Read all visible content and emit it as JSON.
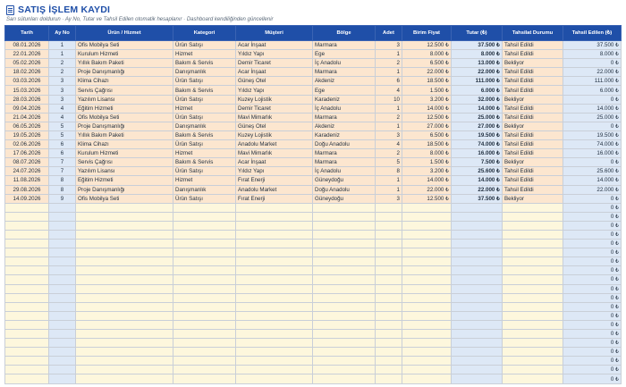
{
  "header": {
    "title": "SATIŞ İŞLEM KAYDI",
    "subtitle": "Sarı sütunları doldurun · Ay No, Tutar ve Tahsil Edilen otomatik hesaplanır · Dashboard kendiliğinden güncellenir"
  },
  "columns": [
    "Tarih",
    "Ay No",
    "Ürün / Hizmet",
    "Kategori",
    "Müşteri",
    "Bölge",
    "Adet",
    "Birim Fiyat",
    "Tutar (₺)",
    "Tahsilat Durumu",
    "Tahsil Edilen (₺)"
  ],
  "rows": [
    [
      "08.01.2026",
      "1",
      "Ofis Mobilya Seti",
      "Ürün Satışı",
      "Acar İnşaat",
      "Marmara",
      "3",
      "12.500 ₺",
      "37.500 ₺",
      "Tahsil Edildi",
      "37.500 ₺"
    ],
    [
      "22.01.2026",
      "1",
      "Kurulum Hizmeti",
      "Hizmet",
      "Yıldız Yapı",
      "Ege",
      "1",
      "8.000 ₺",
      "8.000 ₺",
      "Tahsil Edildi",
      "8.000 ₺"
    ],
    [
      "05.02.2026",
      "2",
      "Yıllık Bakım Paketi",
      "Bakım & Servis",
      "Demir Ticaret",
      "İç Anadolu",
      "2",
      "6.500 ₺",
      "13.000 ₺",
      "Bekliyor",
      "0 ₺"
    ],
    [
      "18.02.2026",
      "2",
      "Proje Danışmanlığı",
      "Danışmanlık",
      "Acar İnşaat",
      "Marmara",
      "1",
      "22.000 ₺",
      "22.000 ₺",
      "Tahsil Edildi",
      "22.000 ₺"
    ],
    [
      "03.03.2026",
      "3",
      "Klima Cihazı",
      "Ürün Satışı",
      "Güneş Otel",
      "Akdeniz",
      "6",
      "18.500 ₺",
      "111.000 ₺",
      "Tahsil Edildi",
      "111.000 ₺"
    ],
    [
      "15.03.2026",
      "3",
      "Servis Çağrısı",
      "Bakım & Servis",
      "Yıldız Yapı",
      "Ege",
      "4",
      "1.500 ₺",
      "6.000 ₺",
      "Tahsil Edildi",
      "6.000 ₺"
    ],
    [
      "28.03.2026",
      "3",
      "Yazılım Lisansı",
      "Ürün Satışı",
      "Kuzey Lojistik",
      "Karadeniz",
      "10",
      "3.200 ₺",
      "32.000 ₺",
      "Bekliyor",
      "0 ₺"
    ],
    [
      "09.04.2026",
      "4",
      "Eğitim Hizmeti",
      "Hizmet",
      "Demir Ticaret",
      "İç Anadolu",
      "1",
      "14.000 ₺",
      "14.000 ₺",
      "Tahsil Edildi",
      "14.000 ₺"
    ],
    [
      "21.04.2026",
      "4",
      "Ofis Mobilya Seti",
      "Ürün Satışı",
      "Mavi Mimarlık",
      "Marmara",
      "2",
      "12.500 ₺",
      "25.000 ₺",
      "Tahsil Edildi",
      "25.000 ₺"
    ],
    [
      "06.05.2026",
      "5",
      "Proje Danışmanlığı",
      "Danışmanlık",
      "Güneş Otel",
      "Akdeniz",
      "1",
      "27.000 ₺",
      "27.000 ₺",
      "Bekliyor",
      "0 ₺"
    ],
    [
      "19.05.2026",
      "5",
      "Yıllık Bakım Paketi",
      "Bakım & Servis",
      "Kuzey Lojistik",
      "Karadeniz",
      "3",
      "6.500 ₺",
      "19.500 ₺",
      "Tahsil Edildi",
      "19.500 ₺"
    ],
    [
      "02.06.2026",
      "6",
      "Klima Cihazı",
      "Ürün Satışı",
      "Anadolu Market",
      "Doğu Anadolu",
      "4",
      "18.500 ₺",
      "74.000 ₺",
      "Tahsil Edildi",
      "74.000 ₺"
    ],
    [
      "17.06.2026",
      "6",
      "Kurulum Hizmeti",
      "Hizmet",
      "Mavi Mimarlık",
      "Marmara",
      "2",
      "8.000 ₺",
      "16.000 ₺",
      "Tahsil Edildi",
      "16.000 ₺"
    ],
    [
      "08.07.2026",
      "7",
      "Servis Çağrısı",
      "Bakım & Servis",
      "Acar İnşaat",
      "Marmara",
      "5",
      "1.500 ₺",
      "7.500 ₺",
      "Bekliyor",
      "0 ₺"
    ],
    [
      "24.07.2026",
      "7",
      "Yazılım Lisansı",
      "Ürün Satışı",
      "Yıldız Yapı",
      "İç Anadolu",
      "8",
      "3.200 ₺",
      "25.600 ₺",
      "Tahsil Edildi",
      "25.600 ₺"
    ],
    [
      "11.08.2026",
      "8",
      "Eğitim Hizmeti",
      "Hizmet",
      "Fırat Enerji",
      "Güneydoğu",
      "1",
      "14.000 ₺",
      "14.000 ₺",
      "Tahsil Edildi",
      "14.000 ₺"
    ],
    [
      "29.08.2026",
      "8",
      "Proje Danışmanlığı",
      "Danışmanlık",
      "Anadolu Market",
      "Doğu Anadolu",
      "1",
      "22.000 ₺",
      "22.000 ₺",
      "Tahsil Edildi",
      "22.000 ₺"
    ],
    [
      "14.09.2026",
      "9",
      "Ofis Mobilya Seti",
      "Ürün Satışı",
      "Fırat Enerji",
      "Güneydoğu",
      "3",
      "12.500 ₺",
      "37.500 ₺",
      "Bekliyor",
      "0 ₺"
    ]
  ],
  "empty_rows": 20,
  "empty_collected_value": "0 ₺"
}
